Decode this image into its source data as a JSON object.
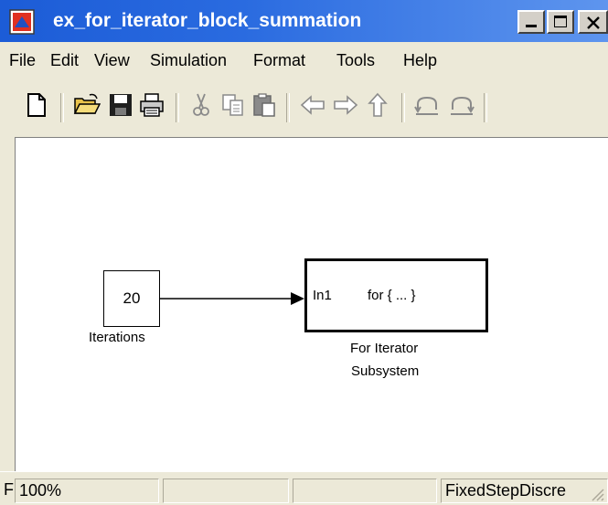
{
  "window": {
    "title": "ex_for_iterator_block_summation"
  },
  "menu": {
    "items": [
      "File",
      "Edit",
      "View",
      "Simulation",
      "Format",
      "Tools",
      "Help"
    ]
  },
  "toolbar": {
    "icons": [
      "new-file-icon",
      "open-folder-icon",
      "save-icon",
      "print-icon",
      "cut-icon",
      "copy-icon",
      "paste-icon",
      "back-arrow-icon",
      "forward-arrow-icon",
      "up-arrow-icon",
      "undo-icon",
      "redo-icon"
    ]
  },
  "diagram": {
    "constant_block": {
      "value": "20",
      "label": "Iterations"
    },
    "subsystem_block": {
      "port_label": "In1",
      "content": "for { ... }",
      "label_line1": "For Iterator",
      "label_line2": "Subsystem"
    }
  },
  "status": {
    "prefix": "F",
    "zoom": "100%",
    "panel2": "",
    "panel3": "",
    "solver": "FixedStepDiscre"
  }
}
